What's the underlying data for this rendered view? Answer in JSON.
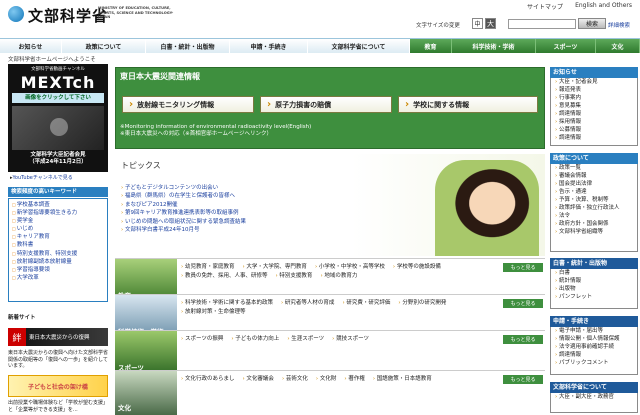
{
  "header": {
    "logo_text": "文部科学省",
    "logo_en": "MINISTRY OF EDUCATION, CULTURE, SPORTS, SCIENCE AND TECHNOLOGY-JAPAN",
    "sitemap": "サイトマップ",
    "english": "English and Others",
    "fontsize_label": "文字サイズの変更",
    "fs_mid": "中",
    "fs_big": "大",
    "search_btn": "検索",
    "adv_search": "詳細検索"
  },
  "nav": [
    "お知らせ",
    "政策について",
    "白書・統計・出版物",
    "申請・手続き",
    "文部科学省について",
    "教育",
    "科学技術・学術",
    "スポーツ",
    "文化"
  ],
  "welcome": "文部科学省ホームページへようこそ",
  "mext": {
    "top": "文部科学省動画チャンネル",
    "title": "MEXTch",
    "click": "画像をクリックして下さい",
    "caption1": "文部科学大臣記者会見",
    "caption2": "（平成24年11月2日）",
    "youtube": "YouTubeチャンネルで見る"
  },
  "keywords": {
    "head": "検索頻度の高いキーワード",
    "items": [
      "学校基本調査",
      "新学習指導要領生きる力",
      "奨学金",
      "いじめ",
      "キャリア教育",
      "教科書",
      "特別支援教育、特別支援",
      "放射線副読本放射線量",
      "学習指導要領",
      "大学改革"
    ]
  },
  "new_site": {
    "label": "新着サイト",
    "recover_kanji": "絆",
    "recover": "東日本大震災からの復興",
    "recover_desc": "東日本大震災からの復興へ向けた文部科学省関係の取組等の「復興への一歩」を紹介しています。",
    "kodomo": "子どもと社会の架け橋",
    "kodomo_desc": "出前授業や職場体験など「学校が望む支援」と「企業等ができる支援」を..."
  },
  "quake": {
    "title": "東日本大震災関連情報",
    "btn1": "放射線モニタリング情報",
    "btn2": "原子力損害の賠償",
    "btn3": "学校に関する情報",
    "link1": "※Monitoring information of environmental radioactivity level(English)",
    "link2": "※東日本大震災への対応（※首相官邸ホームページへリンク）"
  },
  "topics": {
    "title": "トピックス",
    "items": [
      "子どもとデジタルコンテンツの出会い",
      "福島県（群馬県）の在学生と保護者の皆様へ",
      "まなびピア2012開催",
      "第9回キャリア教育推進連携表彰等の取組事例",
      "いじめの問題への取組状況に関する緊急調査結果",
      "文部科学白書平成24年10月号"
    ]
  },
  "categories": [
    {
      "label": "教育",
      "links": [
        "幼児教育・家庭教育",
        "大学・大学院、専門教育",
        "小学校・中学校・高等学校",
        "学校等の施設設備",
        "教員の免許、採用、人事、研修等",
        "特別支援教育",
        "地域の教育力"
      ],
      "more": "もっと見る"
    },
    {
      "label": "科学技術・学術",
      "links": [
        "科学技術・学術に関する基本的政策",
        "研究者等人材の育成",
        "研究費・研究評価",
        "分野別の研究開発",
        "放射線対策・生命倫理等"
      ],
      "more": "もっと見る"
    },
    {
      "label": "スポーツ",
      "links": [
        "スポーツの振興",
        "子どもの体力向上",
        "生涯スポーツ",
        "競技スポーツ"
      ],
      "more": "もっと見る"
    },
    {
      "label": "文化",
      "links": [
        "文化行政のあらまし",
        "文化審議会",
        "芸術文化",
        "文化財",
        "著作権",
        "国語施策・日本語教育"
      ],
      "more": "もっと見る"
    }
  ],
  "right": {
    "news_head": "お知らせ",
    "news": [
      "大臣・記者会見",
      "報道発表",
      "行事案内",
      "意見募集",
      "調達情報",
      "採用情報",
      "公募情報",
      "調達情報"
    ],
    "policy_head": "政策について",
    "policy": [
      "政策一覧",
      "審議会情報",
      "国会提出法律",
      "告示・通達",
      "予算・決算、税制等",
      "政策評価・独立行政法人",
      "法令",
      "政府方針・国会関係",
      "文部科学省組織等"
    ],
    "white_head": "白書・統計・出版物",
    "white": [
      "白書",
      "統計情報",
      "出版物",
      "パンフレット"
    ],
    "apply_head": "申請・手続き",
    "apply": [
      "電子申請・届出等",
      "情報公開・個人情報保護",
      "法令適用事前確認手続",
      "調達情報",
      "パブリックコメント"
    ],
    "about_head": "文部科学省について",
    "about": [
      "大臣・副大臣・政務官"
    ]
  }
}
